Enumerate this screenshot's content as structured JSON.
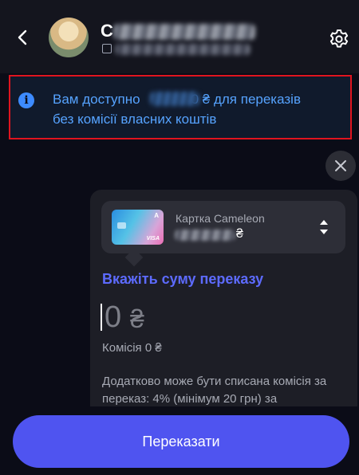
{
  "header": {
    "contact_name": "C",
    "back_icon": "chevron-left-icon",
    "settings_icon": "gear-icon"
  },
  "info_banner": {
    "line1_start": "Вам доступно",
    "line1_end": "0 ₴ для переказів",
    "line2": "без комісії власних коштів",
    "icon": "info-icon",
    "text_color": "#56a3ff",
    "border_color": "#e0141f"
  },
  "card": {
    "name": "Картка Cameleon",
    "bank_mark": "A",
    "network": "VISA",
    "currency": "₴"
  },
  "transfer_form": {
    "title": "Вкажіть суму переказу",
    "amount": "0",
    "currency": "₴",
    "commission": "Комісія 0 ₴",
    "note": "Додатково може бути списана комісія за переказ: 4% (мінімум 20 грн) за"
  },
  "actions": {
    "transfer_label": "Переказати"
  },
  "colors": {
    "accent": "#4f54f0",
    "title_accent": "#5d6bff",
    "background": "#0b0c17",
    "panel": "#1d1e26"
  }
}
